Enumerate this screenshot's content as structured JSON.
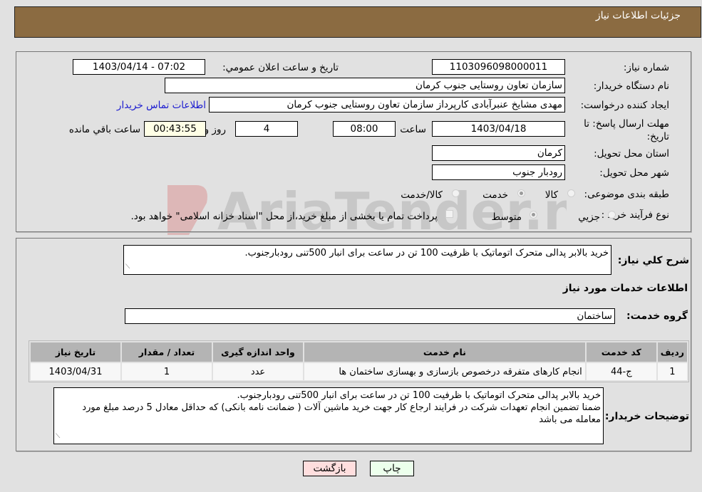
{
  "header": {
    "title": "جزئیات اطلاعات نیاز"
  },
  "details": {
    "need_number_label": "شماره نیاز:",
    "need_number": "1103096098000011",
    "announce_label": "تاریخ و ساعت اعلان عمومي:",
    "announce_value": "1403/04/14 - 07:02",
    "buyer_org_label": "نام دستگاه خريدار:",
    "buyer_org": "سازمان تعاون روستایی جنوب کرمان",
    "creator_label": "ایجاد کننده درخواست:",
    "creator": "مهدی مشایخ عنبرآبادی کارپرداز سازمان تعاون روستایی جنوب کرمان",
    "contact_link": "اطلاعات تماس خریدار",
    "deadline_label": "مهلت ارسال پاسخ: تا تاریخ:",
    "deadline_date": "1403/04/18",
    "time_label": "ساعت",
    "deadline_time": "08:00",
    "days_value": "4",
    "days_label": "روز و",
    "remaining_time": "00:43:55",
    "remaining_label": "ساعت باقي مانده",
    "province_label": "استان محل تحویل:",
    "province": "کرمان",
    "city_label": "شهر محل تحویل:",
    "city": "رودبار جنوب",
    "category_label": "طبقه بندی موضوعی:",
    "category_options": [
      {
        "label": "کالا",
        "checked": false
      },
      {
        "label": "خدمت",
        "checked": true
      },
      {
        "label": "کالا/خدمت",
        "checked": false
      }
    ],
    "process_label": "نوع فرآیند خرید :",
    "process_options": [
      {
        "label": "جزيي",
        "checked": false
      },
      {
        "label": "متوسط",
        "checked": true
      }
    ],
    "treasury_note": "پرداخت تمام یا بخشی از مبلغ خرید،از محل \"اسناد خزانه اسلامی\" خواهد بود."
  },
  "summary": {
    "label": "شرح کلي نياز:",
    "text": "خرید بالابر پدالی متحرک اتوماتیک  با ظرفیت 100 تن در ساعت برای انبار 500تنی رودبارجنوب.",
    "services_heading": "اطلاعات خدمات مورد نیاز",
    "service_group_label": "گروه خدمت:",
    "service_group": "ساختمان"
  },
  "table": {
    "headers": [
      "ردیف",
      "کد خدمت",
      "نام خدمت",
      "واحد اندازه گیری",
      "تعداد / مقدار",
      "تاریخ نیاز"
    ],
    "rows": [
      [
        "1",
        "ج-44",
        "انجام کارهای متفرقه درخصوص بازسازی و بهسازی ساختمان ها",
        "عدد",
        "1",
        "1403/04/31"
      ]
    ]
  },
  "buyer_notes": {
    "label": "توضیحات خریدار:",
    "lines": [
      "خرید بالابر پدالی متحرک اتوماتیک  با ظرفیت 100 تن در ساعت برای انبار 500تنی رودبارجنوب.",
      "ضمنا تضمین انجام تعهدات شرکت در فرایند ارجاع کار جهت خرید ماشین آلات ( ضمانت نامه بانکی) که حداقل معادل 5 درصد مبلغ مورد معامله می باشد"
    ]
  },
  "buttons": {
    "print": "چاپ",
    "back": "بازگشت"
  },
  "colors": {
    "header_bg": "#8b6b41",
    "print_bg": "#ecffec",
    "back_bg": "#ffdede",
    "link": "#1a1ad0",
    "countdown_bg": "#ffffe6"
  },
  "watermark": {
    "text": "AriaTender.net"
  }
}
